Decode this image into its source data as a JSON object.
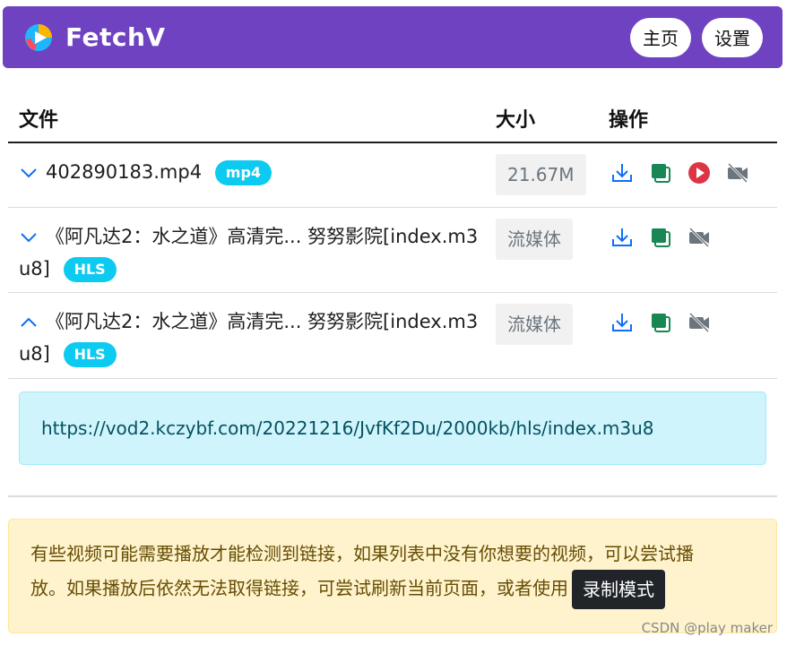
{
  "header": {
    "app_name": "FetchV",
    "home_label": "主页",
    "settings_label": "设置",
    "accent": "#6f42c1"
  },
  "table": {
    "columns": [
      "文件",
      "大小",
      "操作"
    ],
    "rows": [
      {
        "expanded": false,
        "name": "402890183.mp4",
        "badge": "mp4",
        "size": "21.67M",
        "icons": [
          "download-icon",
          "copy-icon",
          "play-icon",
          "record-off-icon"
        ]
      },
      {
        "expanded": false,
        "name_line1": "《阿凡达2：水之道》高清完... 努努影院[index.m3",
        "name_line2": "u8]",
        "badge": "HLS",
        "size": "流媒体",
        "icons": [
          "download-icon",
          "copy-icon",
          "record-off-icon"
        ]
      },
      {
        "expanded": true,
        "name_line1": "《阿凡达2：水之道》高清完... 努努影院[index.m3",
        "name_line2": "u8]",
        "badge": "HLS",
        "size": "流媒体",
        "icons": [
          "download-icon",
          "copy-icon",
          "record-off-icon"
        ]
      }
    ]
  },
  "url_detail": "https://vod2.kczybf.com/20221216/JvfKf2Du/2000kb/hls/index.m3u8",
  "notice": {
    "line1": "有些视频可能需要播放才能检测到链接，如果列表中没有你想要的视频，可以尝试播",
    "line2": "放。如果播放后依然无法取得链接，可尝试刷新当前页面，或者使用",
    "button": "录制模式"
  },
  "watermark": "CSDN @play maker"
}
